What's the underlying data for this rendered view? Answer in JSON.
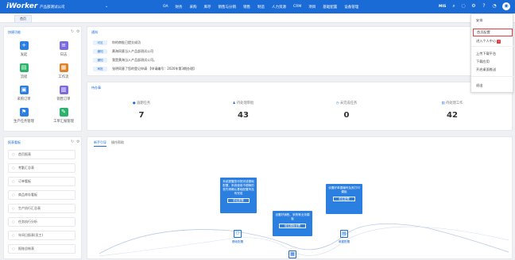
{
  "header": {
    "logo": "iWorker",
    "company": "产品部测试公司",
    "nav": [
      "OA",
      "财务",
      "采购",
      "库存",
      "销售与分销",
      "销售",
      "制造",
      "人力资源",
      "CRM",
      "项目",
      "基础配置",
      "设备管理"
    ],
    "user": "MIS"
  },
  "tabs": {
    "home": "首页"
  },
  "quick": {
    "title": "快捷功能",
    "items": [
      {
        "label": "发起",
        "icon": "plus-icon",
        "color": "#2b7fe0"
      },
      {
        "label": "日志",
        "icon": "log-icon",
        "color": "#7b6be0"
      },
      {
        "label": "流程",
        "icon": "process-icon",
        "color": "#2bb36b"
      },
      {
        "label": "工作流",
        "icon": "workflow-icon",
        "color": "#e0812b"
      },
      {
        "label": "采购订单",
        "icon": "purchase-icon",
        "color": "#2b7fe0"
      },
      {
        "label": "销售订单",
        "icon": "sales-icon",
        "color": "#7b6be0"
      },
      {
        "label": "生产任务管理",
        "icon": "production-icon",
        "color": "#2b7fe0"
      },
      {
        "label": "工单汇报管理",
        "icon": "report-icon",
        "color": "#2bb36b"
      }
    ]
  },
  "reports": {
    "title": "报表看板",
    "items": [
      "首页报表",
      "考勤汇总表",
      "订单看板",
      "商品库存看板",
      "生产执行汇总表",
      "任务执行分析",
      "年间日报表(员工)",
      "报账总帐表"
    ]
  },
  "notice": {
    "title": "通知",
    "rows": [
      {
        "badge": "可见",
        "text": "你的审批已提交成功"
      },
      {
        "badge": "通知",
        "text": "黄海同意当入产品部测试公司"
      },
      {
        "badge": "通知",
        "text": "我是黄海当入产品部测试公司。"
      },
      {
        "badge": "审批",
        "text": "张明同意了您的登记申请  【申请编号：2020年第3期办理】"
      }
    ]
  },
  "todo": {
    "title": "待办事",
    "stats": [
      {
        "label": "逾期任务",
        "value": "7",
        "icon": "alert-icon"
      },
      {
        "label": "待处理审批",
        "value": "43",
        "icon": "person-icon"
      },
      {
        "label": "未完成任务",
        "value": "0",
        "icon": "clock-icon"
      },
      {
        "label": "待处理工作",
        "value": "42",
        "icon": "list-icon"
      }
    ]
  },
  "flow": {
    "tabs": [
      "新手引导",
      "操作帮助"
    ],
    "boxes": [
      {
        "text": "系统提醒您尽快完成基础配置，系统使用不顺畅的首先得确认基础配置有没有完成",
        "btn": "前往配置"
      },
      {
        "text": "设置好销售、采购等业务模板",
        "btn": "前往模板设置"
      },
      {
        "text": "设置好单据编号及其打印模板",
        "btn": "前往配置"
      }
    ],
    "captions": [
      "基础配置",
      "业务模板",
      "单据配置"
    ]
  },
  "dropdown": {
    "items": [
      "安排",
      "首页配置",
      "进入个人中心",
      "上传下载平台",
      "下载应用",
      "开启桌面推送",
      "退出"
    ]
  }
}
